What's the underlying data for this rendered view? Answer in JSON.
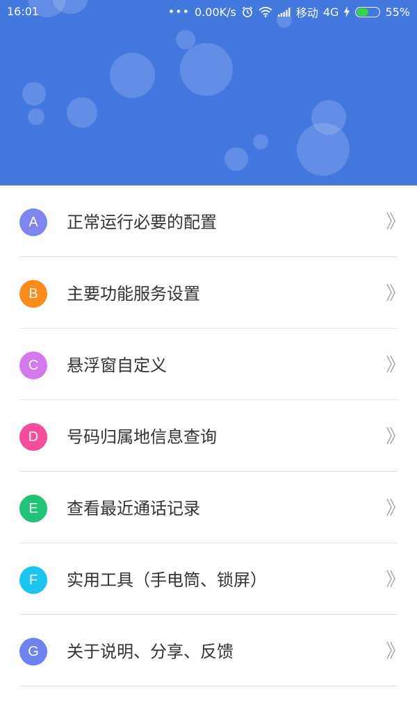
{
  "status_bar": {
    "time": "16:01",
    "dots": "•••",
    "net_speed": "0.00K/s",
    "carrier": "移动",
    "network": "4G",
    "battery_percent": "55%",
    "battery_level": 0.55,
    "icons": [
      "alarm-icon",
      "wifi-icon",
      "signal-icon",
      "charging-icon",
      "battery-icon"
    ]
  },
  "colors": {
    "header": "#4378df",
    "badge_a": "#7e86ee",
    "badge_b": "#fb8b1a",
    "badge_c": "#d279ec",
    "badge_d": "#f54c9e",
    "badge_e": "#22c277",
    "badge_f": "#1cc4f1",
    "badge_g": "#6c82ee",
    "battery": "#35d447"
  },
  "menu": {
    "items": [
      {
        "letter": "A",
        "label": "正常运行必要的配置",
        "color": "#7e86ee"
      },
      {
        "letter": "B",
        "label": "主要功能服务设置",
        "color": "#fb8b1a"
      },
      {
        "letter": "C",
        "label": "悬浮窗自定义",
        "color": "#d279ec"
      },
      {
        "letter": "D",
        "label": "号码归属地信息查询",
        "color": "#f54c9e"
      },
      {
        "letter": "E",
        "label": "查看最近通话记录",
        "color": "#22c277"
      },
      {
        "letter": "F",
        "label": "实用工具（手电筒、锁屏）",
        "color": "#1cc4f1"
      },
      {
        "letter": "G",
        "label": "关于说明、分享、反馈",
        "color": "#6c82ee"
      }
    ],
    "chevron_icon": "double-chevron-right-icon"
  }
}
